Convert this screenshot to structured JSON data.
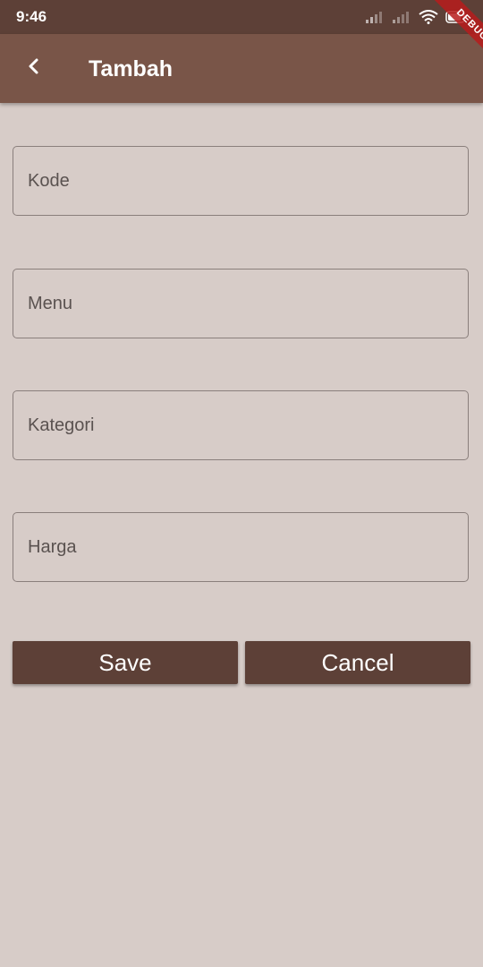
{
  "status_bar": {
    "time": "9:46",
    "icons": [
      "signal-icon",
      "signal-icon",
      "wifi-icon",
      "battery-icon"
    ]
  },
  "app_bar": {
    "title": "Tambah",
    "back_icon": "chevron-left-icon"
  },
  "debug_banner": "DEBUG",
  "form": {
    "fields": [
      {
        "label": "Kode",
        "value": ""
      },
      {
        "label": "Menu",
        "value": ""
      },
      {
        "label": "Kategori",
        "value": ""
      },
      {
        "label": "Harga",
        "value": ""
      }
    ]
  },
  "actions": {
    "save_label": "Save",
    "cancel_label": "Cancel"
  },
  "colors": {
    "status_bar": "#5d4037",
    "app_bar": "#795548",
    "background": "#d7ccc8",
    "button": "#5d4037",
    "debug_ribbon": "#b71c1c"
  }
}
